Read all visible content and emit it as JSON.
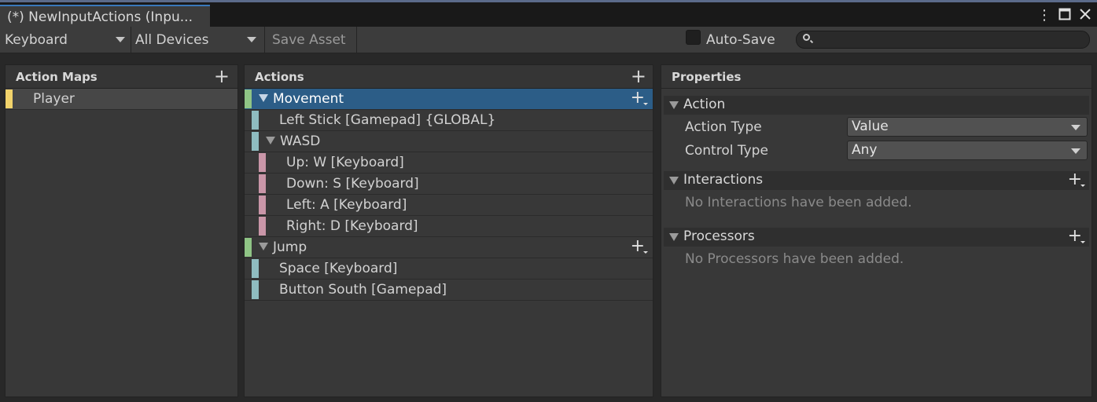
{
  "window": {
    "tab_title": "(*) NewInputActions (Inpu...",
    "icons": [
      "kebab-menu-icon",
      "maximize-icon",
      "close-icon"
    ]
  },
  "toolbar": {
    "control_scheme": "Keyboard",
    "devices": "All Devices",
    "save_asset": "Save Asset",
    "auto_save_label": "Auto-Save",
    "auto_save_checked": false,
    "search_placeholder": ""
  },
  "action_maps": {
    "header": "Action Maps",
    "items": [
      {
        "label": "Player",
        "color": "#f2d36b"
      }
    ]
  },
  "actions": {
    "header": "Actions",
    "rows": [
      {
        "label": "Movement",
        "type": "action",
        "color": "#8fc485",
        "selected": true
      },
      {
        "label": "Left Stick [Gamepad] {GLOBAL}",
        "type": "binding",
        "color": "#8fbcc0"
      },
      {
        "label": "WASD",
        "type": "composite",
        "color": "#8fbcc0"
      },
      {
        "label": "Up: W [Keyboard]",
        "type": "part",
        "color": "#c996a8"
      },
      {
        "label": "Down: S [Keyboard]",
        "type": "part",
        "color": "#c996a8"
      },
      {
        "label": "Left: A [Keyboard]",
        "type": "part",
        "color": "#c996a8"
      },
      {
        "label": "Right: D [Keyboard]",
        "type": "part",
        "color": "#c996a8"
      },
      {
        "label": "Jump",
        "type": "action",
        "color": "#8fc485"
      },
      {
        "label": "Space [Keyboard]",
        "type": "binding",
        "color": "#8fbcc0"
      },
      {
        "label": "Button South [Gamepad]",
        "type": "binding",
        "color": "#8fbcc0"
      }
    ]
  },
  "properties": {
    "header": "Properties",
    "action_section": "Action",
    "action_type_label": "Action Type",
    "action_type_value": "Value",
    "control_type_label": "Control Type",
    "control_type_value": "Any",
    "interactions_section": "Interactions",
    "interactions_empty": "No Interactions have been added.",
    "processors_section": "Processors",
    "processors_empty": "No Processors have been added."
  }
}
